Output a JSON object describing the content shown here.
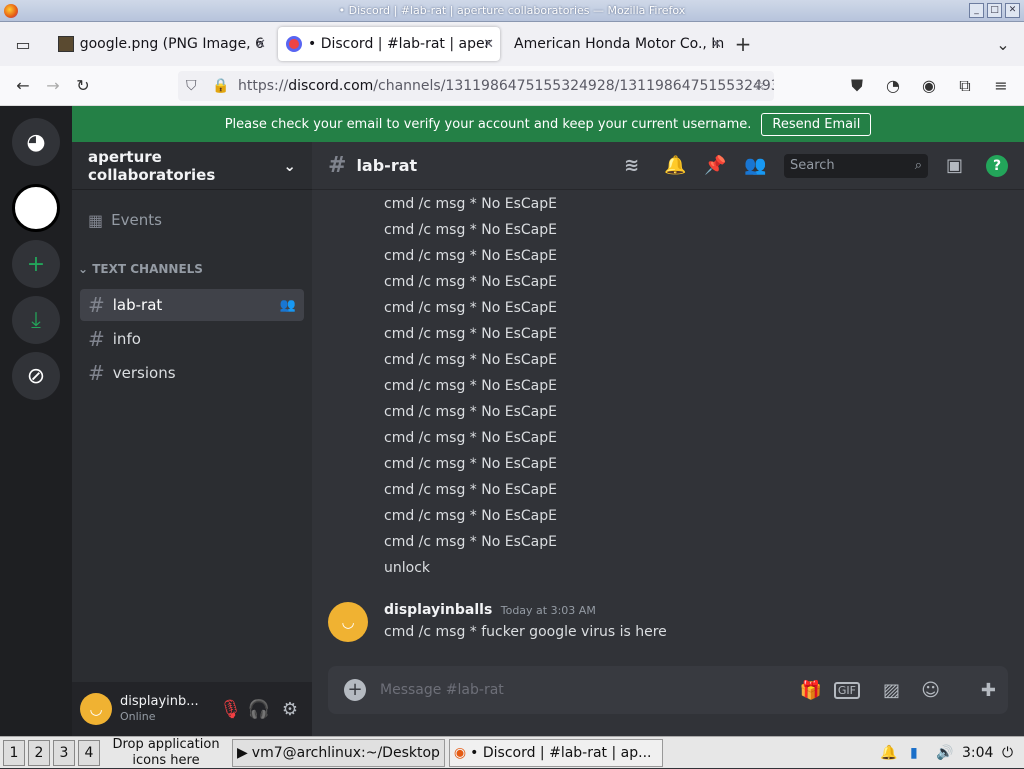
{
  "window": {
    "title": "• Discord | #lab-rat | aperture collaboratories — Mozilla Firefox"
  },
  "tabs": [
    {
      "label": "google.png (PNG Image, 6"
    },
    {
      "label": "• Discord | #lab-rat | aper"
    },
    {
      "label": "American Honda Motor Co., In"
    }
  ],
  "url": {
    "prefix": "https://",
    "host": "discord.com",
    "path": "/channels/1311986475155324928/131198647515532493"
  },
  "banner": {
    "text": "Please check your email to verify your account and keep your current username.",
    "button": "Resend Email"
  },
  "server": {
    "name": "aperture collaboratories",
    "events": "Events",
    "category": "TEXT CHANNELS"
  },
  "channels": [
    {
      "name": "lab-rat"
    },
    {
      "name": "info"
    },
    {
      "name": "versions"
    }
  ],
  "header": {
    "channel": "lab-rat",
    "search_placeholder": "Search"
  },
  "messages": {
    "repeat_line": "cmd /c msg * No EsCapE",
    "unlock": "unlock",
    "author": "displayinballs",
    "timestamp": "Today at 3:03 AM",
    "last": "cmd /c msg * fucker google virus is here"
  },
  "input": {
    "placeholder": "Message #lab-rat"
  },
  "user": {
    "name": "displayinb...",
    "status": "Online"
  },
  "taskbar": {
    "ws": [
      "1",
      "2",
      "3",
      "4"
    ],
    "drop": "Drop application icons here",
    "term": "vm7@archlinux:~/Desktop",
    "ff": "• Discord | #lab-rat | ap...",
    "time": "3:04"
  }
}
